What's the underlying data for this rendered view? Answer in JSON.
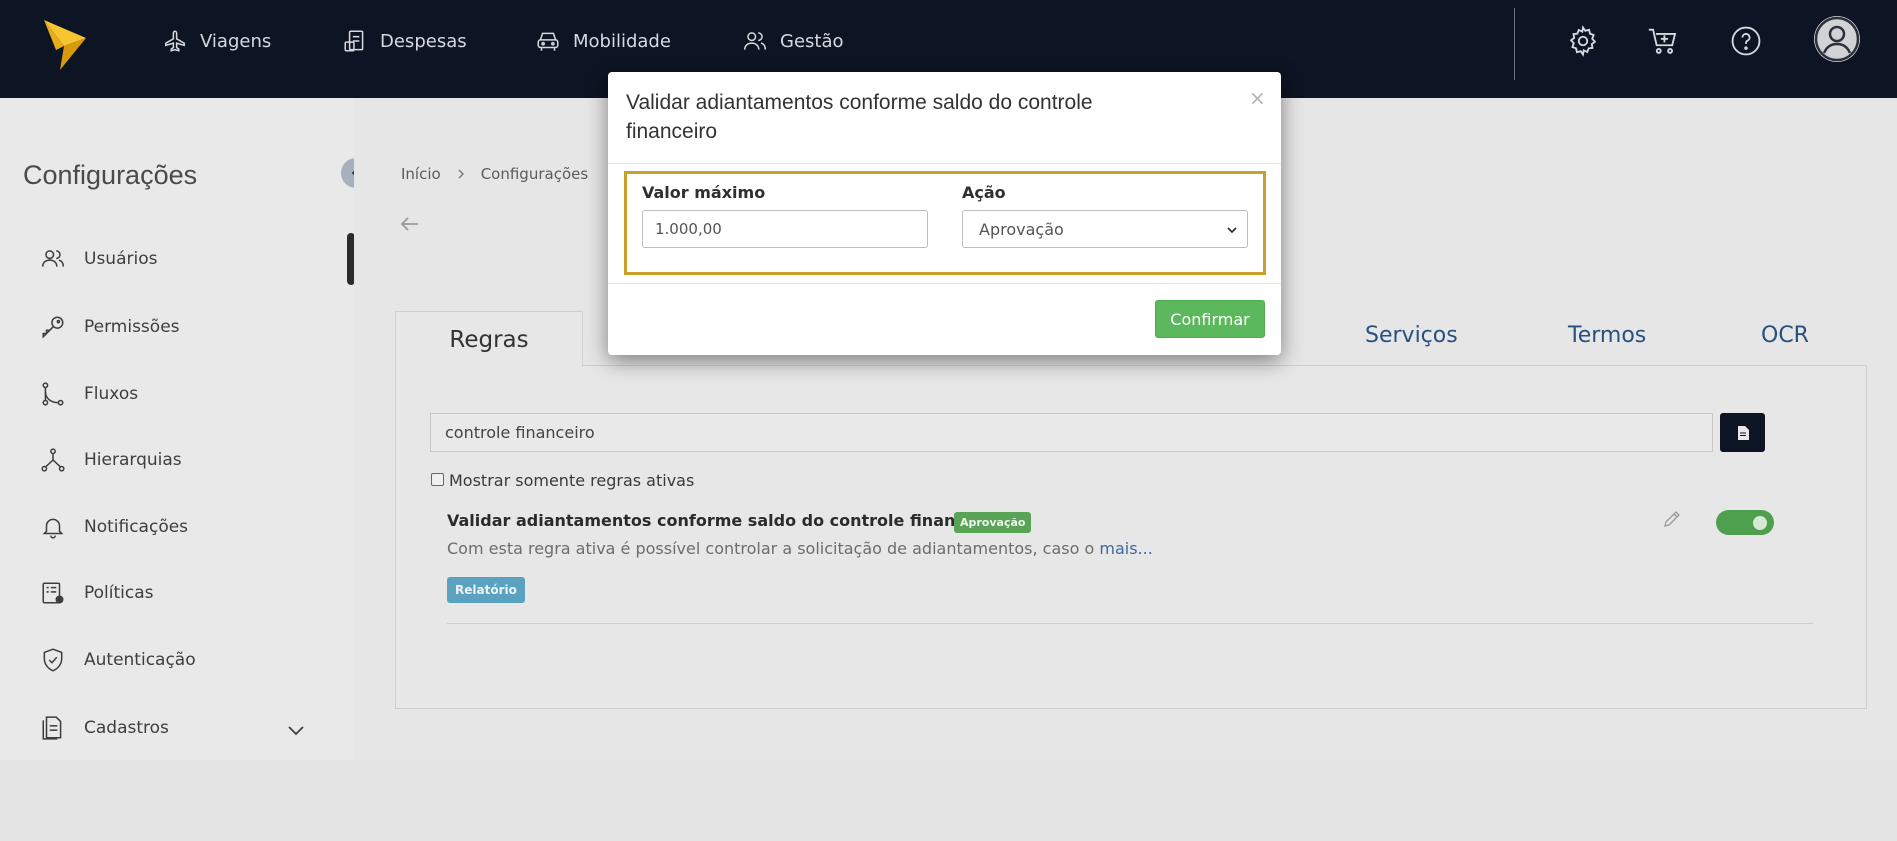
{
  "topnav": {
    "items": [
      {
        "label": "Viagens",
        "icon": "plane-icon"
      },
      {
        "label": "Despesas",
        "icon": "receipt-icon"
      },
      {
        "label": "Mobilidade",
        "icon": "car-icon"
      },
      {
        "label": "Gestão",
        "icon": "users-icon"
      }
    ],
    "right_icons": [
      "gear-icon",
      "cart-icon",
      "help-icon",
      "avatar-icon"
    ],
    "colors": {
      "background": "#0d1423",
      "logo": "#f2b705"
    }
  },
  "sidebar": {
    "title": "Configurações",
    "items": [
      {
        "label": "Usuários",
        "icon": "users-icon"
      },
      {
        "label": "Permissões",
        "icon": "key-icon"
      },
      {
        "label": "Fluxos",
        "icon": "flow-icon"
      },
      {
        "label": "Hierarquias",
        "icon": "hierarchy-icon"
      },
      {
        "label": "Notificações",
        "icon": "bell-icon"
      },
      {
        "label": "Políticas",
        "icon": "policy-icon"
      },
      {
        "label": "Autenticação",
        "icon": "shield-icon"
      },
      {
        "label": "Cadastros",
        "icon": "document-icon"
      }
    ]
  },
  "breadcrumb": {
    "items": [
      "Início",
      "Configurações"
    ]
  },
  "tabs": {
    "active": "Regras",
    "others": [
      "Serviços",
      "Termos",
      "OCR"
    ]
  },
  "search": {
    "value": "controle financeiro"
  },
  "filter": {
    "label": "Mostrar somente regras ativas",
    "checked": false
  },
  "rule": {
    "title": "Validar adiantamentos conforme saldo do controle financeiro",
    "badge": "Aprovação",
    "description": "Com esta regra ativa é possível controlar a solicitação de adiantamentos, caso o",
    "more_link": "mais...",
    "tag": "Relatório",
    "enabled": true
  },
  "modal": {
    "title": "Validar adiantamentos conforme saldo do controle financeiro",
    "close": "×",
    "max_label": "Valor máximo",
    "max_value": "1.000,00",
    "action_label": "Ação",
    "action_value": "Aprovação",
    "confirm_label": "Confirmar",
    "colors": {
      "highlight": "#c9a12a",
      "confirm": "#5cb85c"
    }
  }
}
